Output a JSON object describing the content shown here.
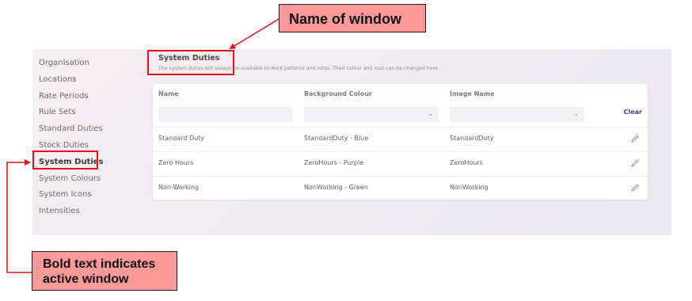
{
  "sidebar": {
    "items": [
      {
        "label": "Organisation",
        "active": false
      },
      {
        "label": "Locations",
        "active": false
      },
      {
        "label": "Rate Periods",
        "active": false
      },
      {
        "label": "Rule Sets",
        "active": false
      },
      {
        "label": "Standard Duties",
        "active": false
      },
      {
        "label": "Stock Duties",
        "active": false
      },
      {
        "label": "System Duties",
        "active": true
      },
      {
        "label": "System Colours",
        "active": false
      },
      {
        "label": "System Icons",
        "active": false
      },
      {
        "label": "Intensities",
        "active": false
      }
    ]
  },
  "page": {
    "title": "System Duties",
    "description": "The system duties will always be available to work patterns and rotas. Their colour and icon can be changed here."
  },
  "table": {
    "columns": [
      "Name",
      "Background Colour",
      "Image Name"
    ],
    "filters": {
      "name": "",
      "background_colour": "",
      "image_name": ""
    },
    "clear_label": "Clear",
    "rows": [
      {
        "name": "Standard Duty",
        "background": "StandardDuty - Blue",
        "image": "StandardDuty"
      },
      {
        "name": "Zero Hours",
        "background": "ZeroHours - Purple",
        "image": "ZeroHours"
      },
      {
        "name": "Non-Working",
        "background": "NonWorking - Green",
        "image": "NonWorking"
      }
    ]
  },
  "annotations": {
    "window_name": "Name of window",
    "bold_text_line1": "Bold text indicates",
    "bold_text_line2": "active window"
  },
  "colors": {
    "callout_fill": "#fc9a9a",
    "highlight": "#e0141d",
    "accent": "#4b3a8c"
  },
  "icons": {
    "dropdown": "chevron-down-icon",
    "edit": "pencil-icon"
  }
}
